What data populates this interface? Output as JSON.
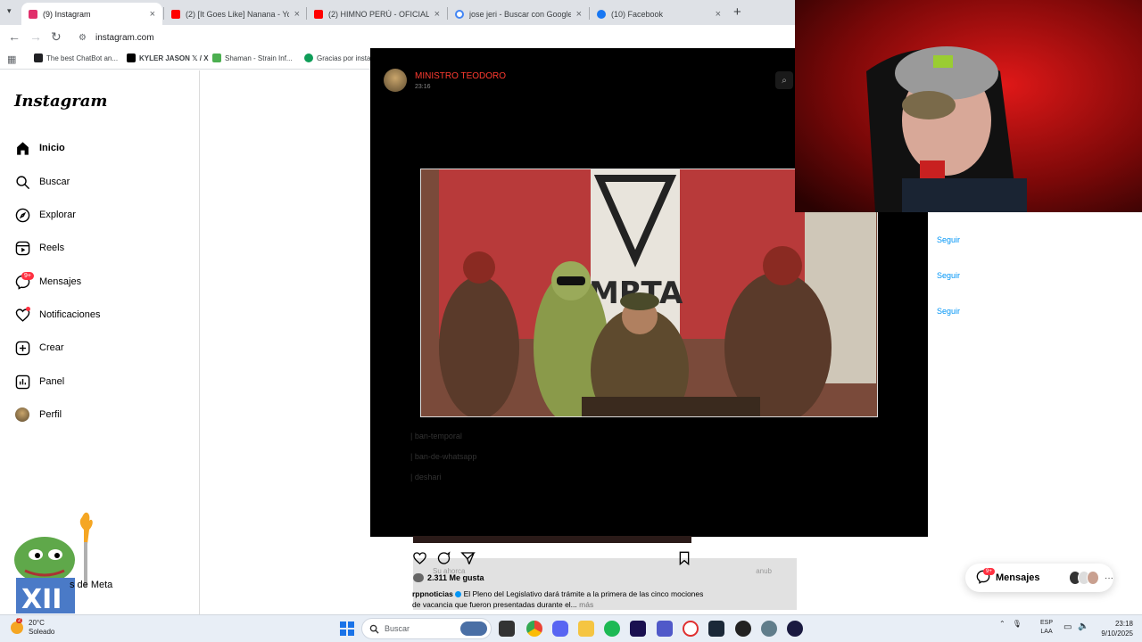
{
  "browser": {
    "tabs": [
      {
        "title": "(9) Instagram",
        "active": true,
        "color": "#e1306c"
      },
      {
        "title": "(2) [It Goes Like] Nanana - YouTube",
        "active": false,
        "color": "#ff0000"
      },
      {
        "title": "(2) HIMNO PERÚ - OFICIAL - YouTube",
        "active": false,
        "color": "#ff0000"
      },
      {
        "title": "jose jeri - Buscar con Google",
        "active": false,
        "color": "#4285f4"
      },
      {
        "title": "(10) Facebook",
        "active": false,
        "color": "#1877f2"
      }
    ],
    "url": "instagram.com",
    "bookmarks": [
      {
        "label": "The best ChatBot an...",
        "color": "#202124"
      },
      {
        "label": "KYLER JASON 𝕏 / X",
        "color": "#000000"
      },
      {
        "label": "Shaman - Strain Inf...",
        "color": "#4caf50"
      },
      {
        "label": "Gracias por insta",
        "color": "#0f9d58"
      }
    ]
  },
  "sidebar": {
    "logo": "Instagram",
    "items": [
      {
        "label": "Inicio",
        "icon": "home-icon"
      },
      {
        "label": "Buscar",
        "icon": "search-icon"
      },
      {
        "label": "Explorar",
        "icon": "compass-icon"
      },
      {
        "label": "Reels",
        "icon": "reels-icon"
      },
      {
        "label": "Mensajes",
        "icon": "messenger-icon"
      },
      {
        "label": "Notificaciones",
        "icon": "heart-icon"
      },
      {
        "label": "Crear",
        "icon": "plus-square-icon"
      },
      {
        "label": "Panel",
        "icon": "chart-icon"
      },
      {
        "label": "Perfil",
        "icon": "profile-avatar"
      }
    ],
    "messages_badge": "9+",
    "meta_text": "s de Meta"
  },
  "post": {
    "username": "MINISTRO TEODORO",
    "time": "23:16",
    "likes": "2.311 Me gusta",
    "caption_user": "rppnoticias",
    "caption_text": "El Pleno del Legislativo dará trámite a la primera de las cinco mociones de vacancia que fueron presentadas durante el...",
    "more": "más",
    "ghost_rows": [
      "| ban-temporal",
      "| ban-de-whatsapp",
      "| deshari"
    ],
    "banner_text": "MRTA",
    "gray_left": "Su ahorca",
    "gray_right": "anub"
  },
  "suggestions": {
    "follow_label": "Seguir"
  },
  "messages_pill": {
    "label": "Mensajes",
    "badge": "9+"
  },
  "taskbar": {
    "temperature": "20°C",
    "weather": "Soleado",
    "weather_badge": "2",
    "search_placeholder": "Buscar",
    "lang_top": "ESP",
    "lang_bottom": "LAA",
    "time": "23:18",
    "date": "9/10/2025"
  }
}
